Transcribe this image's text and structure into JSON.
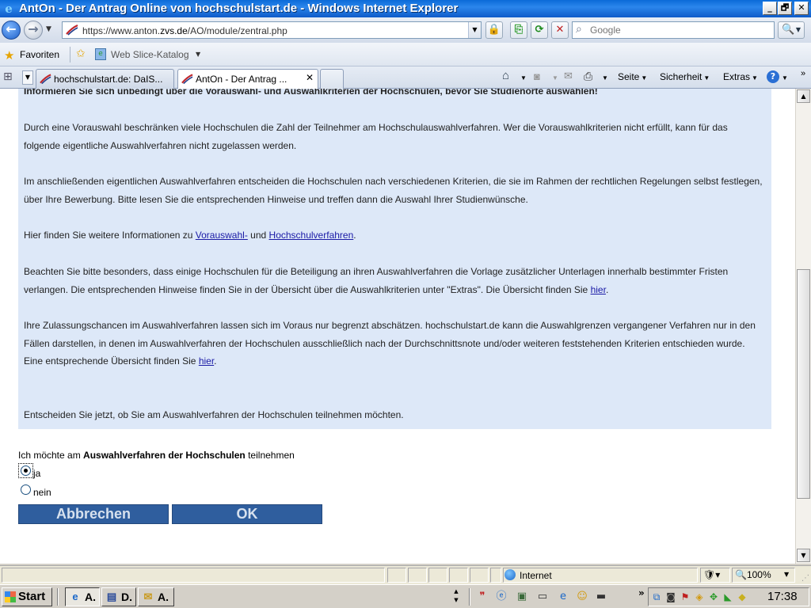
{
  "window": {
    "title": "AntOn - Der Antrag Online von hochschulstart.de - Windows Internet Explorer",
    "minimize": "_",
    "maximize": "🗗",
    "close": "✕"
  },
  "address": {
    "url_prefix": "https://www.anton.",
    "url_domain": "zvs.de",
    "url_path": "/AO/module/zentral.php",
    "search_placeholder": "Google"
  },
  "favorites": {
    "label": "Favoriten",
    "web_slice": "Web Slice-Katalog"
  },
  "tabs": [
    {
      "label": "hochschulstart.de: DaIS..."
    },
    {
      "label": "AntOn - Der Antrag ...",
      "close": "✕"
    }
  ],
  "commandbar": {
    "seite": "Seite",
    "sicherheit": "Sicherheit",
    "extras": "Extras",
    "help": "?"
  },
  "content": {
    "heading": "Informieren Sie sich unbedingt über die Vorauswahl- und Auswahlkriterien der Hochschulen, bevor Sie Studienorte auswählen!",
    "p2": "Durch eine Vorauswahl beschränken viele Hochschulen die Zahl der Teilnehmer am Hochschulauswahlverfahren. Wer die Vorauswahlkriterien nicht erfüllt, kann für das folgende eigentliche Auswahlverfahren nicht zugelassen werden.",
    "p3": "Im anschließenden eigentlichen Auswahlverfahren entscheiden die Hochschulen nach verschiedenen Kriterien, die sie im Rahmen der rechtlichen Regelungen selbst festlegen, über Ihre Bewerbung. Bitte lesen Sie die entsprechenden Hinweise und treffen dann die Auswahl Ihrer Studienwünsche.",
    "p4_pre": "Hier finden Sie weitere Informationen zu ",
    "p4_link1": "Vorauswahl-",
    "p4_mid": " und ",
    "p4_link2": "Hochschulverfahren",
    "p4_post": ".",
    "p5_pre": "Beachten Sie bitte besonders, dass einige Hochschulen für die Beteiligung an ihren Auswahlverfahren die Vorlage zusätzlicher Unterlagen innerhalb bestimmter Fristen verlangen. Die entsprechenden Hinweise finden Sie in der Übersicht über die Auswahlkriterien unter \"Extras\". Die Übersicht finden Sie ",
    "p5_link": "hier",
    "p5_post": ".",
    "p6": "Ihre Zulassungschancen im Auswahlverfahren lassen sich im Voraus nur begrenzt abschätzen. hochschulstart.de kann die Auswahlgrenzen vergangener Verfahren nur in den Fällen darstellen, in denen im Auswahlverfahren der Hochschulen ausschließlich nach der Durchschnittsnote und/oder weiteren feststehenden Kriterien entschieden wurde.",
    "p6b_pre": "Eine entsprechende Übersicht finden Sie ",
    "p6b_link": "hier",
    "p6b_post": ".",
    "p7": "Entscheiden Sie jetzt, ob Sie am Auswahlverfahren der Hochschulen teilnehmen möchten."
  },
  "form": {
    "question_pre": "Ich möchte am ",
    "question_bold": "Auswahlverfahren der Hochschulen",
    "question_post": " teilnehmen",
    "options": [
      {
        "label": "ja",
        "checked": true
      },
      {
        "label": "nein",
        "checked": false
      }
    ],
    "cancel_label": "Abbrechen",
    "ok_label": "OK"
  },
  "status": {
    "zone": "Internet",
    "zoom": "100%"
  },
  "taskbar": {
    "start": "Start",
    "tasks": [
      {
        "label": "A."
      },
      {
        "label": "D."
      },
      {
        "label": "A."
      }
    ],
    "clock": "17:38"
  }
}
